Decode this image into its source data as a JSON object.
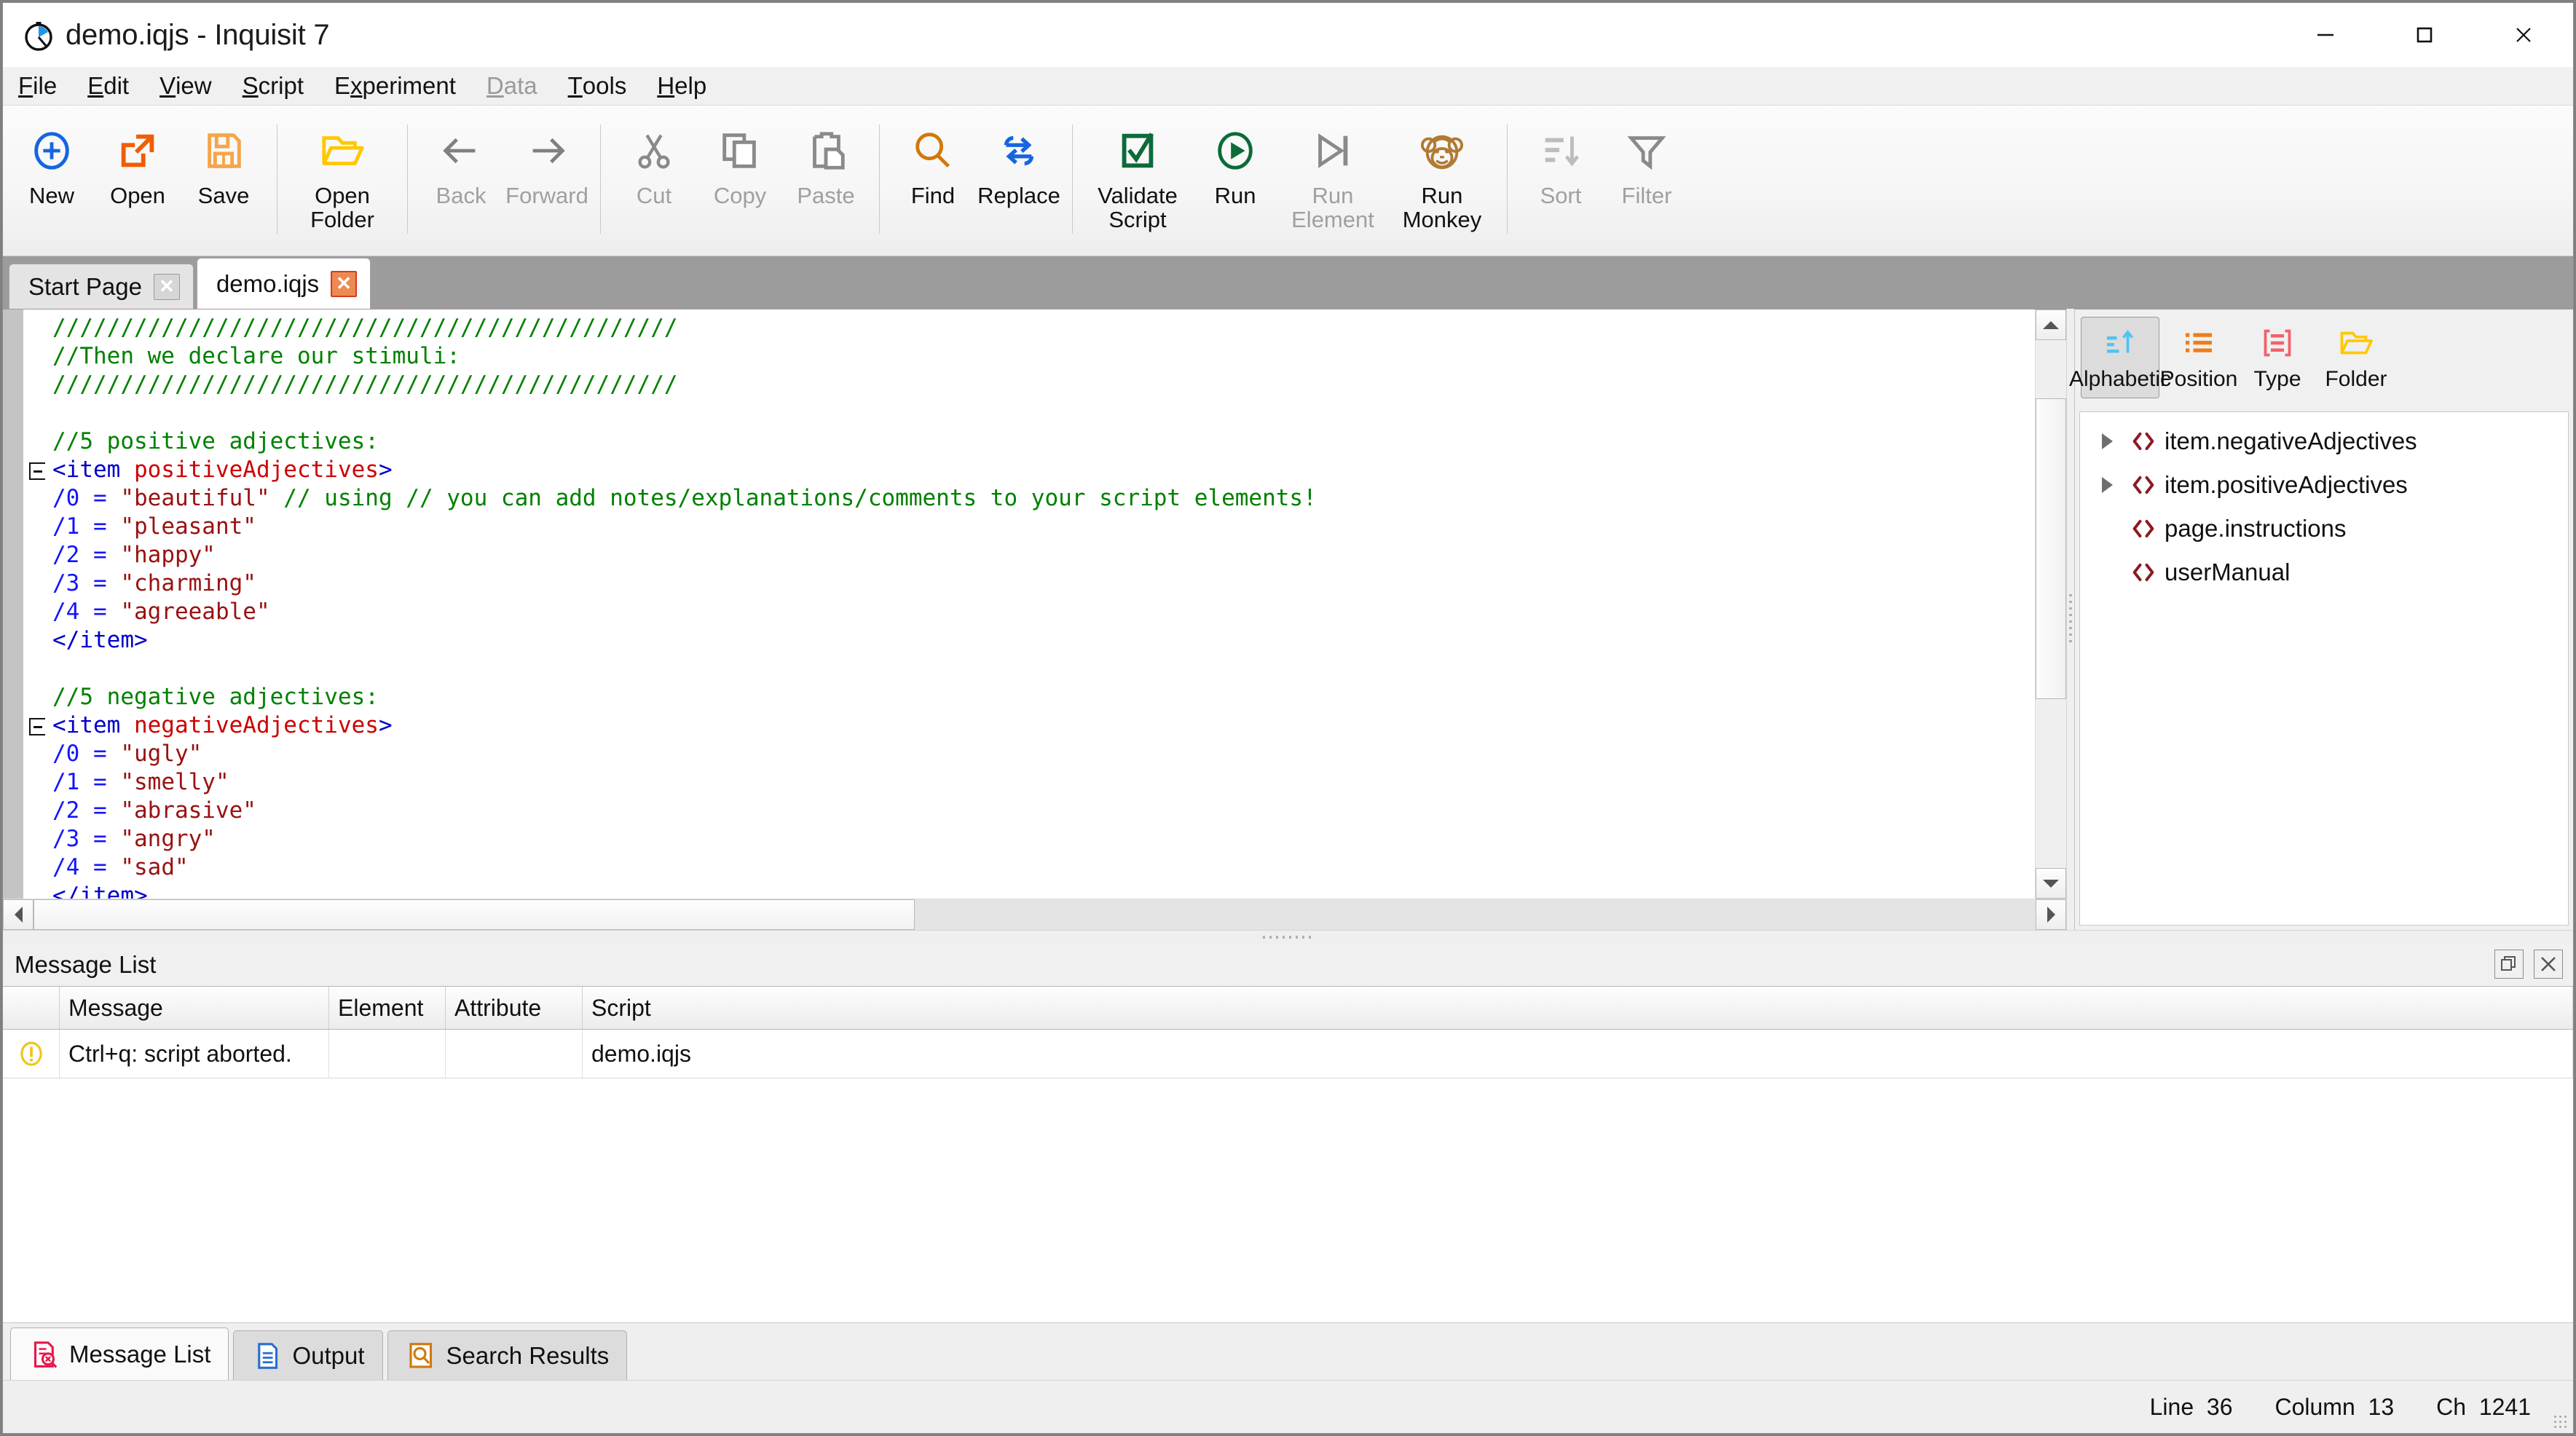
{
  "window": {
    "title": "demo.iqjs - Inquisit 7",
    "app_icon": "stopwatch-icon",
    "controls": {
      "minimize": "minimize-icon",
      "maximize": "maximize-icon",
      "close": "close-icon"
    }
  },
  "menubar": {
    "items": [
      {
        "label": "File",
        "accel": "F",
        "disabled": false
      },
      {
        "label": "Edit",
        "accel": "E",
        "disabled": false
      },
      {
        "label": "View",
        "accel": "V",
        "disabled": false
      },
      {
        "label": "Script",
        "accel": "S",
        "disabled": false
      },
      {
        "label": "Experiment",
        "accel": "x",
        "disabled": false
      },
      {
        "label": "Data",
        "accel": "D",
        "disabled": true
      },
      {
        "label": "Tools",
        "accel": "T",
        "disabled": false
      },
      {
        "label": "Help",
        "accel": "H",
        "disabled": false
      }
    ]
  },
  "toolbar": {
    "groups": [
      {
        "buttons": [
          {
            "label": "New",
            "icon": "plus-circle-icon",
            "color": "#1565e0",
            "disabled": false
          },
          {
            "label": "Open",
            "icon": "open-external-icon",
            "color": "#f25c05",
            "disabled": false
          },
          {
            "label": "Save",
            "icon": "floppy-disk-icon",
            "color": "#f5a54a",
            "disabled": false
          }
        ]
      },
      {
        "buttons": [
          {
            "label": "Open\nFolder",
            "icon": "open-folder-icon",
            "color": "#ffc800",
            "disabled": false
          }
        ]
      },
      {
        "buttons": [
          {
            "label": "Back",
            "icon": "arrow-left-icon",
            "color": "#808080",
            "disabled": true
          },
          {
            "label": "Forward",
            "icon": "arrow-right-icon",
            "color": "#808080",
            "disabled": true
          }
        ]
      },
      {
        "buttons": [
          {
            "label": "Cut",
            "icon": "scissors-icon",
            "color": "#8a8a8a",
            "disabled": true
          },
          {
            "label": "Copy",
            "icon": "copy-icon",
            "color": "#8a8a8a",
            "disabled": true
          },
          {
            "label": "Paste",
            "icon": "clipboard-paste-icon",
            "color": "#8a8a8a",
            "disabled": true
          }
        ]
      },
      {
        "buttons": [
          {
            "label": "Find",
            "icon": "magnifier-icon",
            "color": "#d2780a",
            "disabled": false
          },
          {
            "label": "Replace",
            "icon": "loop-arrows-icon",
            "color": "#1565e0",
            "disabled": false
          }
        ]
      },
      {
        "buttons": [
          {
            "label": "Validate\nScript",
            "icon": "checkbox-check-icon",
            "color": "#0b6b3a",
            "disabled": false
          },
          {
            "label": "Run",
            "icon": "play-circle-icon",
            "color": "#0b6b3a",
            "disabled": false
          },
          {
            "label": "Run\nElement",
            "icon": "play-to-end-icon",
            "color": "#8a8a8a",
            "disabled": true
          },
          {
            "label": "Run\nMonkey",
            "icon": "monkey-face-icon",
            "color": "#b07a33",
            "disabled": false
          }
        ]
      },
      {
        "buttons": [
          {
            "label": "Sort",
            "icon": "sort-descending-icon",
            "color": "#bdbdbd",
            "disabled": true
          },
          {
            "label": "Filter",
            "icon": "funnel-icon",
            "color": "#8a8a8a",
            "disabled": true
          }
        ]
      }
    ]
  },
  "document_tabs": [
    {
      "label": "Start Page",
      "active": false,
      "close_icon": "close-icon"
    },
    {
      "label": "demo.iqjs",
      "active": true,
      "close_icon": "close-icon"
    }
  ],
  "editor": {
    "lines": [
      {
        "segments": [
          {
            "t": "//////////////////////////////////////////////",
            "c": "comment"
          }
        ],
        "fold": false
      },
      {
        "segments": [
          {
            "t": "//Then we declare our stimuli:",
            "c": "comment"
          }
        ],
        "fold": false
      },
      {
        "segments": [
          {
            "t": "//////////////////////////////////////////////",
            "c": "comment"
          }
        ],
        "fold": false
      },
      {
        "segments": [
          {
            "t": "",
            "c": "plain"
          }
        ],
        "fold": false
      },
      {
        "segments": [
          {
            "t": "//5 positive adjectives:",
            "c": "comment"
          }
        ],
        "fold": false
      },
      {
        "segments": [
          {
            "t": "<item ",
            "c": "tag"
          },
          {
            "t": "positiveAdjectives",
            "c": "name"
          },
          {
            "t": ">",
            "c": "tag"
          }
        ],
        "fold": true
      },
      {
        "segments": [
          {
            "t": "/0",
            "c": "attr"
          },
          {
            "t": " = ",
            "c": "eq"
          },
          {
            "t": "\"beautiful\"",
            "c": "str"
          },
          {
            "t": " // using // you can add notes/explanations/comments to your script elements!",
            "c": "comment"
          }
        ],
        "fold": false
      },
      {
        "segments": [
          {
            "t": "/1",
            "c": "attr"
          },
          {
            "t": " = ",
            "c": "eq"
          },
          {
            "t": "\"pleasant\"",
            "c": "str"
          }
        ],
        "fold": false
      },
      {
        "segments": [
          {
            "t": "/2",
            "c": "attr"
          },
          {
            "t": " = ",
            "c": "eq"
          },
          {
            "t": "\"happy\"",
            "c": "str"
          }
        ],
        "fold": false
      },
      {
        "segments": [
          {
            "t": "/3",
            "c": "attr"
          },
          {
            "t": " = ",
            "c": "eq"
          },
          {
            "t": "\"charming\"",
            "c": "str"
          }
        ],
        "fold": false
      },
      {
        "segments": [
          {
            "t": "/4",
            "c": "attr"
          },
          {
            "t": " = ",
            "c": "eq"
          },
          {
            "t": "\"agreeable\"",
            "c": "str"
          }
        ],
        "fold": false
      },
      {
        "segments": [
          {
            "t": "</item>",
            "c": "tag"
          }
        ],
        "fold": false
      },
      {
        "segments": [
          {
            "t": "",
            "c": "plain"
          }
        ],
        "fold": false
      },
      {
        "segments": [
          {
            "t": "//5 negative adjectives:",
            "c": "comment"
          }
        ],
        "fold": false
      },
      {
        "segments": [
          {
            "t": "<item ",
            "c": "tag"
          },
          {
            "t": "negativeAdjectives",
            "c": "name"
          },
          {
            "t": ">",
            "c": "tag"
          }
        ],
        "fold": true
      },
      {
        "segments": [
          {
            "t": "/0",
            "c": "attr"
          },
          {
            "t": " = ",
            "c": "eq"
          },
          {
            "t": "\"ugly\"",
            "c": "str"
          }
        ],
        "fold": false
      },
      {
        "segments": [
          {
            "t": "/1",
            "c": "attr"
          },
          {
            "t": " = ",
            "c": "eq"
          },
          {
            "t": "\"smelly\"",
            "c": "str"
          }
        ],
        "fold": false
      },
      {
        "segments": [
          {
            "t": "/2",
            "c": "attr"
          },
          {
            "t": " = ",
            "c": "eq"
          },
          {
            "t": "\"abrasive\"",
            "c": "str"
          }
        ],
        "fold": false
      },
      {
        "segments": [
          {
            "t": "/3",
            "c": "attr"
          },
          {
            "t": " = ",
            "c": "eq"
          },
          {
            "t": "\"angry\"",
            "c": "str"
          }
        ],
        "fold": false
      },
      {
        "segments": [
          {
            "t": "/4",
            "c": "attr"
          },
          {
            "t": " = ",
            "c": "eq"
          },
          {
            "t": "\"sad\"",
            "c": "str"
          }
        ],
        "fold": false
      },
      {
        "segments": [
          {
            "t": "</item>",
            "c": "tag"
          }
        ],
        "fold": false
      }
    ],
    "scroll": {
      "v_thumb_top_pct": 11,
      "v_thumb_height_pct": 57,
      "h_thumb_left_pct": 0,
      "h_thumb_width_pct": 44
    }
  },
  "explorer": {
    "view_buttons": [
      {
        "label": "Alphabetic",
        "icon": "sort-ascending-icon",
        "selected": true
      },
      {
        "label": "Position",
        "icon": "bullet-list-icon",
        "selected": false
      },
      {
        "label": "Type",
        "icon": "type-brackets-icon",
        "selected": false
      },
      {
        "label": "Folder",
        "icon": "open-folder-icon",
        "selected": false
      }
    ],
    "tree_items": [
      {
        "label": "item.negativeAdjectives",
        "icon": "code-brackets-icon",
        "expandable": true
      },
      {
        "label": "item.positiveAdjectives",
        "icon": "code-brackets-icon",
        "expandable": true
      },
      {
        "label": "page.instructions",
        "icon": "code-brackets-icon",
        "expandable": false
      },
      {
        "label": "userManual",
        "icon": "code-brackets-icon",
        "expandable": false
      }
    ]
  },
  "dock": {
    "title": "Message List",
    "float_icon": "restore-window-icon",
    "close_icon": "close-icon",
    "columns": [
      "",
      "Message",
      "Element",
      "Attribute",
      "Script"
    ],
    "rows": [
      {
        "icon": "warning-icon",
        "message": "Ctrl+q: script aborted.",
        "element": "",
        "attribute": "",
        "script": "demo.iqjs"
      }
    ]
  },
  "bottom_tabs": [
    {
      "label": "Message List",
      "icon": "message-list-icon",
      "active": true
    },
    {
      "label": "Output",
      "icon": "output-doc-icon",
      "active": false
    },
    {
      "label": "Search Results",
      "icon": "search-results-icon",
      "active": false
    }
  ],
  "statusbar": {
    "line_label": "Line",
    "line_value": "36",
    "column_label": "Column",
    "column_value": "13",
    "ch_label": "Ch",
    "ch_value": "1241"
  }
}
